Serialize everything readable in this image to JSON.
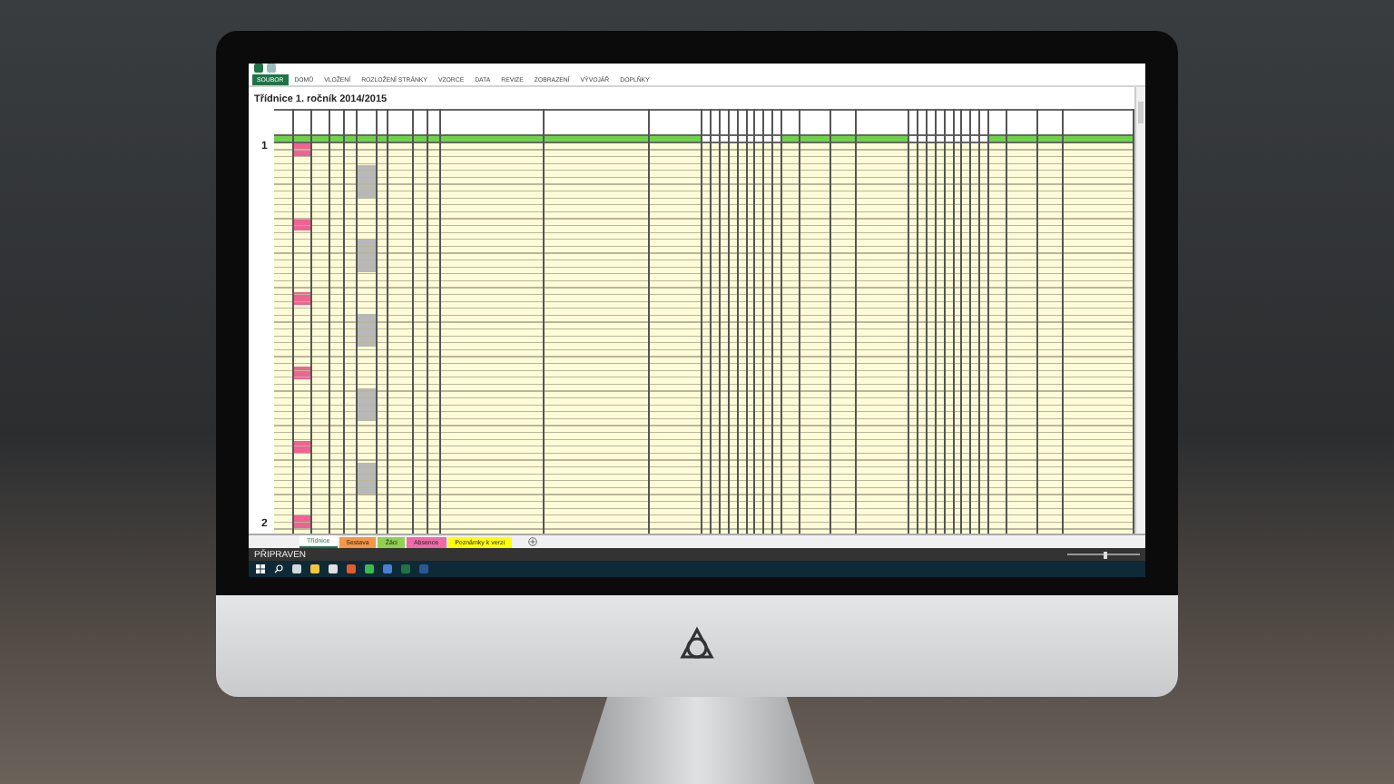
{
  "ribbon_tabs": [
    {
      "label": "SOUBOR",
      "selected": true
    },
    {
      "label": "DOMŮ",
      "selected": false
    },
    {
      "label": "VLOŽENÍ",
      "selected": false
    },
    {
      "label": "ROZLOŽENÍ STRÁNKY",
      "selected": false
    },
    {
      "label": "VZORCE",
      "selected": false
    },
    {
      "label": "DATA",
      "selected": false
    },
    {
      "label": "REVIZE",
      "selected": false
    },
    {
      "label": "ZOBRAZENÍ",
      "selected": false
    },
    {
      "label": "VÝVOJÁŘ",
      "selected": false
    },
    {
      "label": "DOPLŇKY",
      "selected": false
    }
  ],
  "sheet": {
    "title": "Třídnice 1. ročník 2014/2015",
    "row_labels": [
      "1",
      "2"
    ]
  },
  "sheet_tabs": [
    {
      "label": "Třídnice",
      "selected": true,
      "color": "#ffffff"
    },
    {
      "label": "Sestava",
      "selected": false,
      "color": "#f79646"
    },
    {
      "label": "Žáci",
      "selected": false,
      "color": "#92d050"
    },
    {
      "label": "Absence",
      "selected": false,
      "color": "#f06aa8"
    },
    {
      "label": "Poznámky k verzi",
      "selected": false,
      "color": "#ffff00"
    }
  ],
  "status_bar": {
    "text": "PŘIPRAVEN",
    "zoom": {
      "level": 0.5
    }
  }
}
